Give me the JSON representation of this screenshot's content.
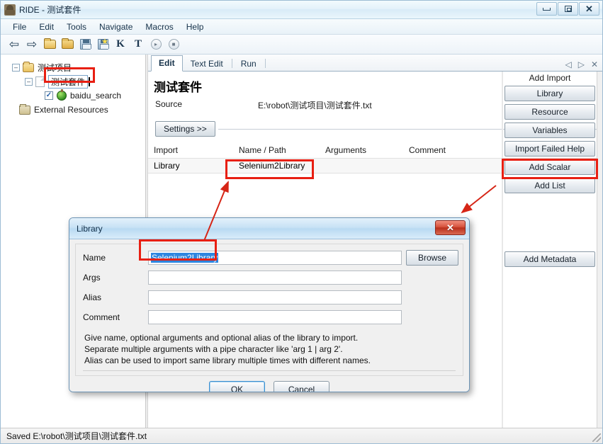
{
  "window": {
    "title": "RIDE - 测试套件",
    "icon": "app-robot-icon",
    "controls": {
      "minimize": "–",
      "maximize": "□",
      "close": "✕"
    }
  },
  "menubar": {
    "items": [
      "File",
      "Edit",
      "Tools",
      "Navigate",
      "Macros",
      "Help"
    ]
  },
  "toolbar": {
    "items": [
      {
        "name": "back-arrow-icon",
        "glyph": "⇦"
      },
      {
        "name": "forward-arrow-icon",
        "glyph": "⇨"
      },
      {
        "name": "open-directory-icon",
        "glyph": ""
      },
      {
        "name": "open-file-icon",
        "glyph": ""
      },
      {
        "name": "save-icon",
        "glyph": ""
      },
      {
        "name": "save-all-icon",
        "glyph": ""
      },
      {
        "name": "keyword-search-icon",
        "glyph": "K"
      },
      {
        "name": "test-search-icon",
        "glyph": "T"
      },
      {
        "name": "run-icon",
        "glyph": "▸"
      },
      {
        "name": "stop-icon",
        "glyph": "■"
      }
    ]
  },
  "tree": {
    "root": {
      "label": "测试项目",
      "expander": "–"
    },
    "suite": {
      "label": "测试套件",
      "expander": "–",
      "editing": true
    },
    "test": {
      "label": "baidu_search",
      "checked": true,
      "check_glyph": "✓"
    },
    "external": {
      "label": "External Resources"
    }
  },
  "editor": {
    "tabs": [
      {
        "label": "Edit",
        "active": true
      },
      {
        "label": "Text Edit",
        "active": false
      },
      {
        "label": "Run",
        "active": false
      }
    ],
    "tab_nav": {
      "prev": "◁",
      "next": "▷",
      "close": "✕"
    },
    "suite_title": "测试套件",
    "source_label": "Source",
    "source_value": "E:\\robot\\测试项目\\测试套件.txt",
    "settings_button": "Settings >>",
    "grid": {
      "headers": [
        "Import",
        "Name / Path",
        "Arguments",
        "Comment"
      ],
      "rows": [
        {
          "import": "Library",
          "name": "Selenium2Library",
          "arguments": "",
          "comment": ""
        }
      ]
    },
    "side_panel": {
      "title": "Add Import",
      "buttons": [
        "Library",
        "Resource",
        "Variables",
        "Import Failed Help",
        "Add Scalar",
        "Add List"
      ],
      "metadata_button": "Add Metadata"
    }
  },
  "statusbar": {
    "message": "Saved E:\\robot\\测试项目\\测试套件.txt"
  },
  "dialog": {
    "title": "Library",
    "close_glyph": "✕",
    "fields": [
      {
        "label": "Name",
        "value": "Selenium2Library",
        "selected": true
      },
      {
        "label": "Args",
        "value": "",
        "selected": false
      },
      {
        "label": "Alias",
        "value": "",
        "selected": false
      },
      {
        "label": "Comment",
        "value": "",
        "selected": false
      }
    ],
    "browse_button": "Browse",
    "help_lines": [
      "Give name, optional arguments and optional alias of the library to import.",
      "Separate multiple arguments with a pipe character like 'arg 1 | arg 2'.",
      "Alias can be used to import same library multiple times with different names."
    ],
    "ok_button": "OK",
    "cancel_button": "Cancel"
  },
  "annotations": {
    "color": "#e81f12",
    "boxes": [
      "tree-suite-item",
      "grid-name-cell",
      "side-library-button",
      "dialog-name-field"
    ],
    "arrows": [
      {
        "from": "dialog-name-field",
        "to": "grid-name-cell"
      },
      {
        "from": "dialog-close-button",
        "to": "side-library-button"
      }
    ]
  }
}
